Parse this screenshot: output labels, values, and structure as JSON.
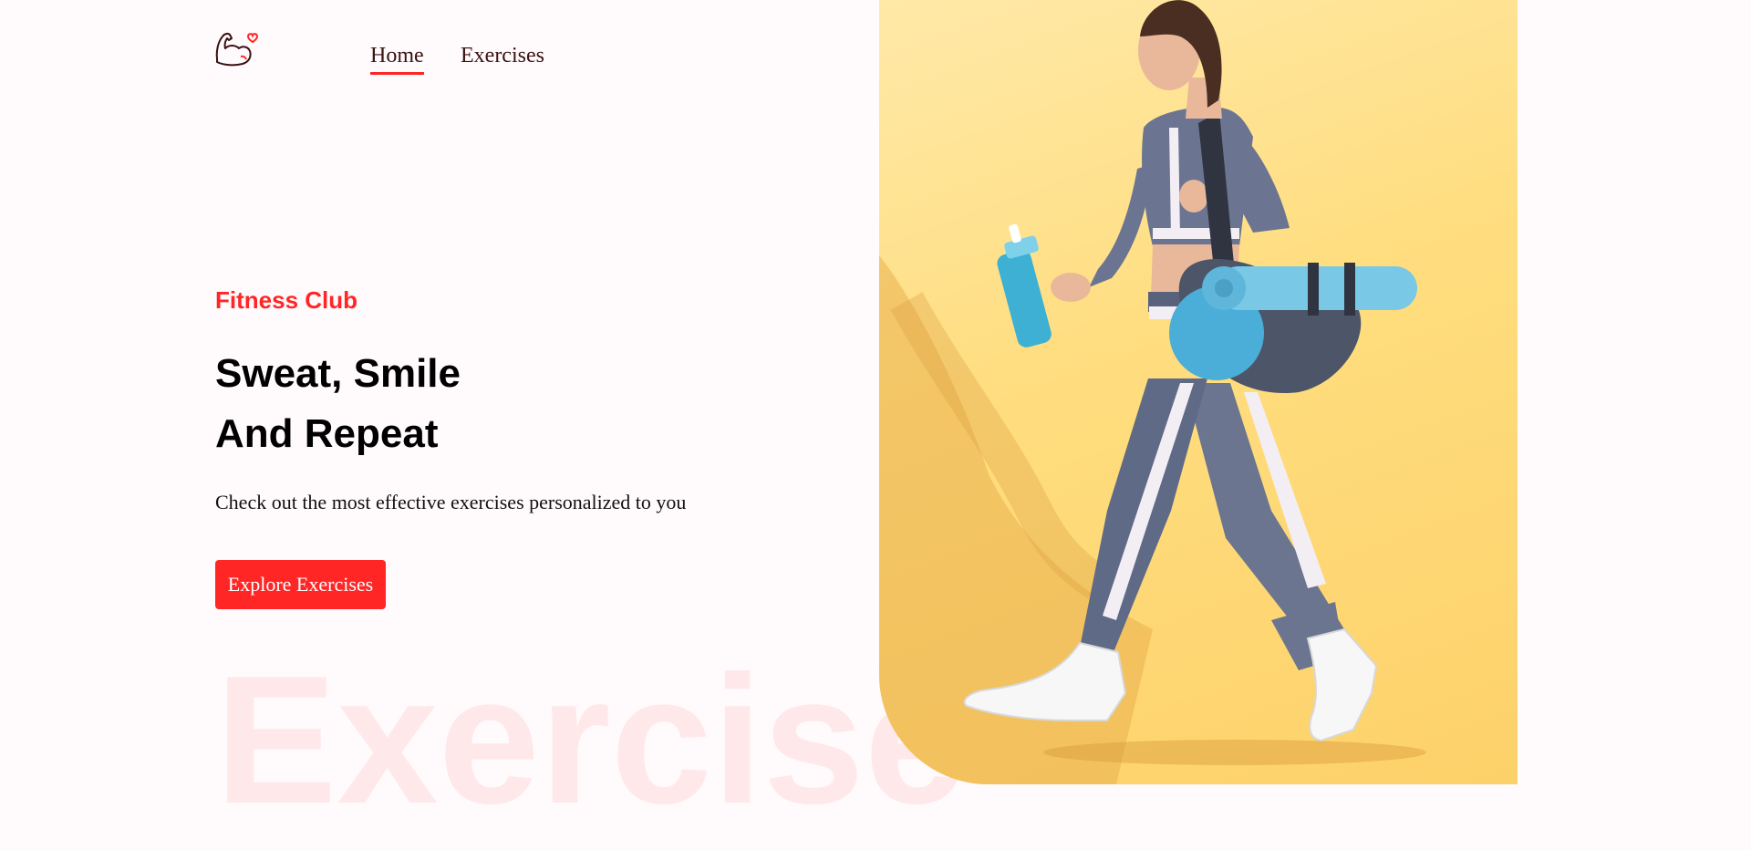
{
  "nav": {
    "logo_icon": "flexed-bicep-heart-icon",
    "links": [
      {
        "label": "Home",
        "active": true
      },
      {
        "label": "Exercises",
        "active": false
      }
    ]
  },
  "hero": {
    "tag": "Fitness Club",
    "title_line1": "Sweat, Smile",
    "title_line2": "And Repeat",
    "subtitle": "Check out the most effective exercises personalized to you",
    "cta_label": "Explore Exercises",
    "watermark": "Exercise"
  },
  "banner": {
    "image": "woman-walking-with-gym-bag-and-water-bottle"
  },
  "colors": {
    "accent": "#ff2625",
    "background": "#fffafb",
    "banner": "#ffdd7e"
  }
}
